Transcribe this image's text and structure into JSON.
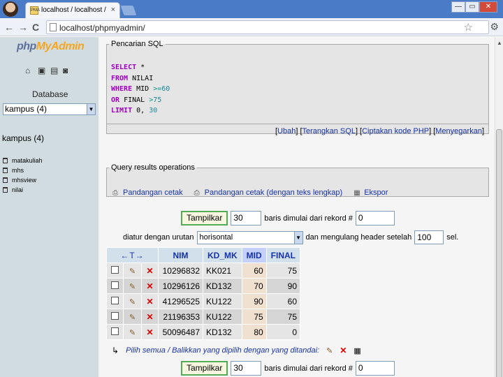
{
  "browser": {
    "tab_title": "localhost / localhost / kampus",
    "tab_close": "×",
    "favicon_text": "PMA",
    "url": "localhost/phpmyadmin/",
    "win_min": "—",
    "win_max": "▭",
    "win_close": "✕",
    "back": "←",
    "forward": "→",
    "reload": "C",
    "star": "☆",
    "wrench": "⚙"
  },
  "sidebar": {
    "logo_php": "php",
    "logo_myadmin": "MyAdmin",
    "icons": [
      "home-icon",
      "sql-icon",
      "docs-icon",
      "query-icon"
    ],
    "database_label": "Database",
    "database_selected": "kampus (4)",
    "db_heading": "kampus (4)",
    "tables": [
      {
        "name": "matakuliah"
      },
      {
        "name": "mhs"
      },
      {
        "name": "mhsview"
      },
      {
        "name": "nilai"
      }
    ]
  },
  "sql_box": {
    "legend": "Pencarian SQL",
    "lines": {
      "l1_kw": "SELECT",
      "l1_rest": " *",
      "l2_kw": "FROM",
      "l2_rest": " NILAI",
      "l3_kw": "WHERE",
      "l3_rest": " MID ",
      "l3_op": ">=",
      "l3_num": "60",
      "l4_kw": "OR",
      "l4_rest": " FINAL ",
      "l4_op": ">",
      "l4_num": "75",
      "l5_kw": "LIMIT",
      "l5_rest": " 0, ",
      "l5_num": "30"
    },
    "links": {
      "ubah": "Ubah",
      "terangkan": "Terangkan SQL",
      "ciptakan": "Ciptakan kode PHP",
      "menyegarkan": "Menyegarkan"
    }
  },
  "query_ops": {
    "legend": "Query results operations",
    "print_view": "Pandangan cetak",
    "print_full": "Pandangan cetak (dengan teks lengkap)",
    "export": "Ekspor"
  },
  "nav_top": {
    "button": "Tampilkar",
    "rows": "30",
    "starting_label": "baris dimulai dari rekord #",
    "start": "0"
  },
  "display_opts": {
    "label": "diatur dengan urutan",
    "mode": "horisontal",
    "repeat_label": "dan mengulang header setelah",
    "repeat": "100",
    "suffix": "sel."
  },
  "table": {
    "arrows": "←T→",
    "columns": [
      "NIM",
      "KD_MK",
      "MID",
      "FINAL"
    ],
    "rows": [
      {
        "nim": "10296832",
        "kd": "KK021",
        "mid": "60",
        "final": "75"
      },
      {
        "nim": "10296126",
        "kd": "KD132",
        "mid": "70",
        "final": "90"
      },
      {
        "nim": "41296525",
        "kd": "KU122",
        "mid": "90",
        "final": "60"
      },
      {
        "nim": "21196353",
        "kd": "KU122",
        "mid": "75",
        "final": "75"
      },
      {
        "nim": "50096487",
        "kd": "KD132",
        "mid": "80",
        "final": "0"
      }
    ]
  },
  "select_all": {
    "text": "Pilih semua / Balikkan yang dipilih",
    "with_selected": "dengan yang ditandai:"
  },
  "nav_bottom": {
    "button": "Tampilkar",
    "rows": "30",
    "starting_label": "baris dimulai dari rekord #",
    "start": "0"
  },
  "colors": {
    "link": "#1632a8",
    "keyword": "#a000c0",
    "left_frame": "#d0dce0"
  }
}
